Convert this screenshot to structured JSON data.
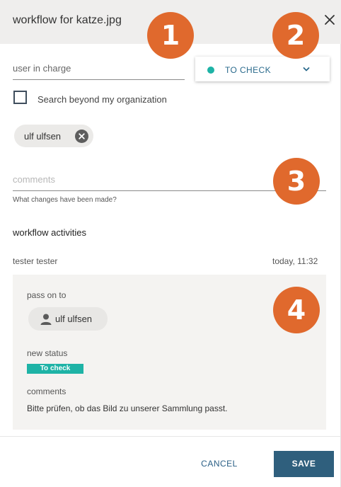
{
  "dialog": {
    "title": "workflow for katze.jpg",
    "close_icon": "close-icon"
  },
  "form": {
    "user_placeholder": "user in charge",
    "status": {
      "label": "TO CHECK",
      "dot_color": "#1eb3a6",
      "chevron_icon": "chevron-down-icon"
    },
    "search_beyond_label": "Search beyond my organization",
    "search_beyond_checked": false,
    "assignee_chip": "ulf ulfsen",
    "comments_placeholder": "comments",
    "comments_helper": "What changes have been made?"
  },
  "activities": {
    "title": "workflow activities",
    "entry": {
      "user": "tester tester",
      "time": "today, 11:32",
      "pass_on_label": "pass on to",
      "pass_on_user": "ulf ulfsen",
      "new_status_label": "new status",
      "new_status_value": "To check",
      "comments_label": "comments",
      "comments_text": "Bitte prüfen, ob das Bild zu unserer Sammlung passt."
    }
  },
  "callouts": [
    "1",
    "2",
    "3",
    "4"
  ],
  "footer": {
    "cancel_label": "CANCEL",
    "save_label": "SAVE"
  },
  "colors": {
    "header_bg": "#efeeed",
    "accent_teal": "#1eb3a6",
    "primary_button": "#2f5f7d",
    "callout_orange": "#e0692d"
  }
}
